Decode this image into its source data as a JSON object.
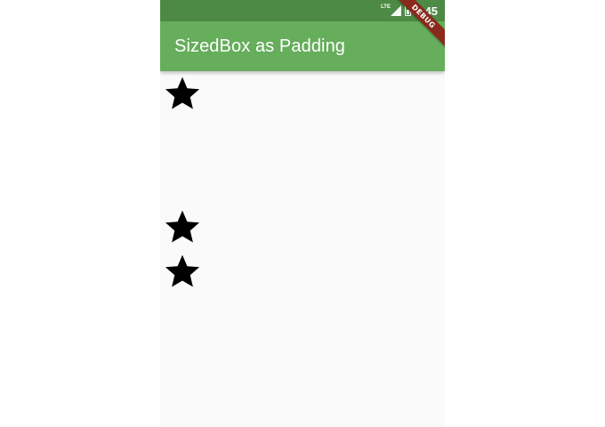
{
  "status_bar": {
    "network_label": "LTE",
    "time": "1:45",
    "color": "#4d8a45"
  },
  "app_bar": {
    "title": "SizedBox as Padding",
    "color": "#66ad5c"
  },
  "debug_banner": {
    "label": "DEBUG",
    "color": "#8a2a1c"
  },
  "content": {
    "background": "#fafafa",
    "stars": [
      {
        "icon": "star-icon",
        "color": "#000000"
      },
      {
        "icon": "star-icon",
        "color": "#000000"
      },
      {
        "icon": "star-icon",
        "color": "#000000"
      }
    ]
  }
}
